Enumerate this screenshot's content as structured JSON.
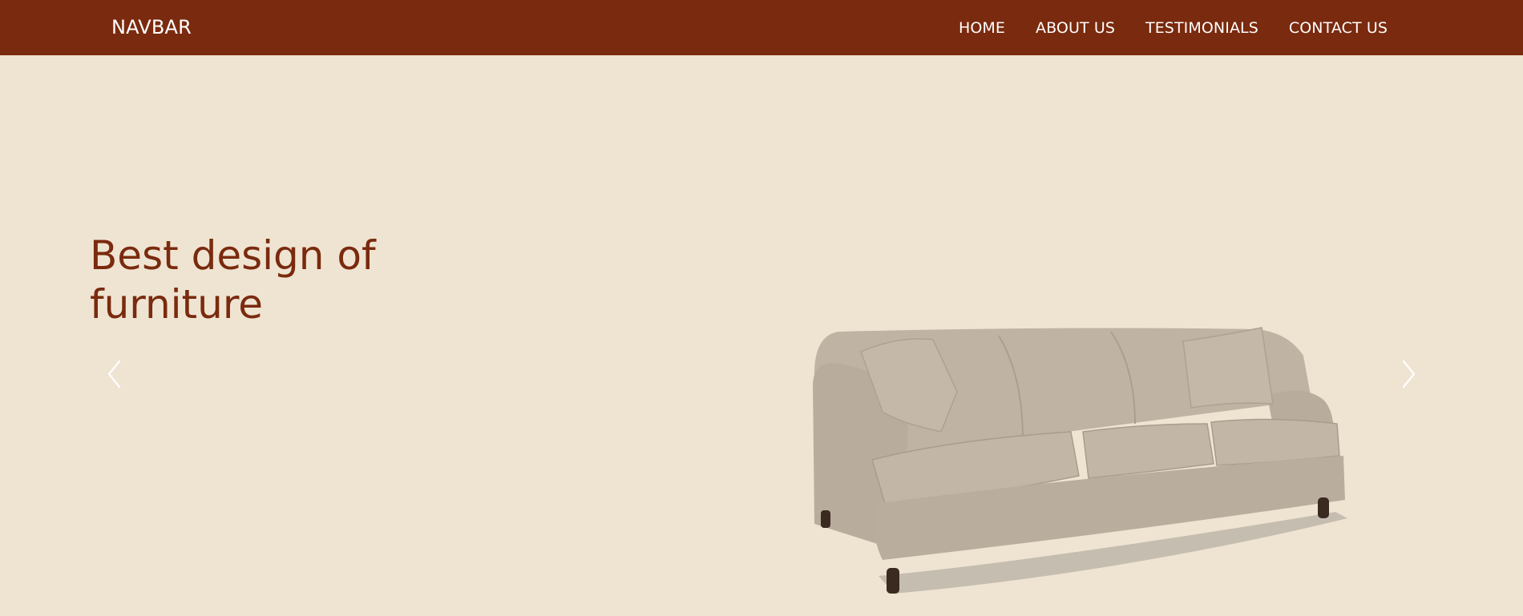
{
  "navbar": {
    "brand": "NAVBAR",
    "links": [
      {
        "label": "HOME"
      },
      {
        "label": "ABOUT US"
      },
      {
        "label": "TESTIMONIALS"
      },
      {
        "label": "CONTACT US"
      }
    ]
  },
  "hero": {
    "headline_line1": "Best design of",
    "headline_line2": "furniture"
  },
  "colors": {
    "navbar_bg": "#7a2a0e",
    "page_bg": "#efe4d2",
    "headline": "#7a2a0e",
    "sofa": "#bfb4a3"
  },
  "icons": {
    "prev": "chevron-left-icon",
    "next": "chevron-right-icon"
  }
}
